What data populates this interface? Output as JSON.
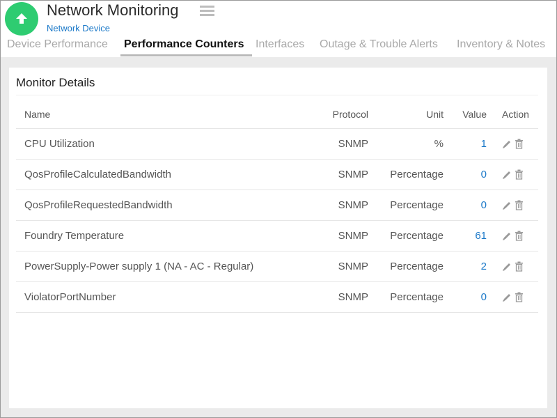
{
  "header": {
    "title": "Network Monitoring",
    "subtitle": "Network Device",
    "status_color": "#2ecc71",
    "status_icon": "arrow-up-icon",
    "menu_icon": "hamburger-menu-icon"
  },
  "tabs": [
    {
      "label": "Device Performance",
      "active": false
    },
    {
      "label": "Performance Counters",
      "active": true
    },
    {
      "label": "Interfaces",
      "active": false
    },
    {
      "label": "Outage & Trouble Alerts",
      "active": false
    },
    {
      "label": "Inventory & Notes",
      "active": false
    }
  ],
  "panel": {
    "title": "Monitor Details",
    "columns": {
      "name": "Name",
      "protocol": "Protocol",
      "unit": "Unit",
      "value": "Value",
      "action": "Action"
    },
    "rows": [
      {
        "name": "CPU Utilization",
        "protocol": "SNMP",
        "unit": "%",
        "value": "1"
      },
      {
        "name": "QosProfileCalculatedBandwidth",
        "protocol": "SNMP",
        "unit": "Percentage",
        "value": "0"
      },
      {
        "name": "QosProfileRequestedBandwidth",
        "protocol": "SNMP",
        "unit": "Percentage",
        "value": "0"
      },
      {
        "name": "Foundry Temperature",
        "protocol": "SNMP",
        "unit": "Percentage",
        "value": "61"
      },
      {
        "name": "PowerSupply-Power supply 1 (NA - AC - Regular)",
        "protocol": "SNMP",
        "unit": "Percentage",
        "value": "2"
      },
      {
        "name": "ViolatorPortNumber",
        "protocol": "SNMP",
        "unit": "Percentage",
        "value": "0"
      }
    ],
    "action_icons": [
      "edit-pencil-icon",
      "delete-trash-icon"
    ]
  },
  "colors": {
    "accent_blue": "#1a78c8",
    "status_green": "#2ecc71",
    "background": "#ebebeb"
  }
}
